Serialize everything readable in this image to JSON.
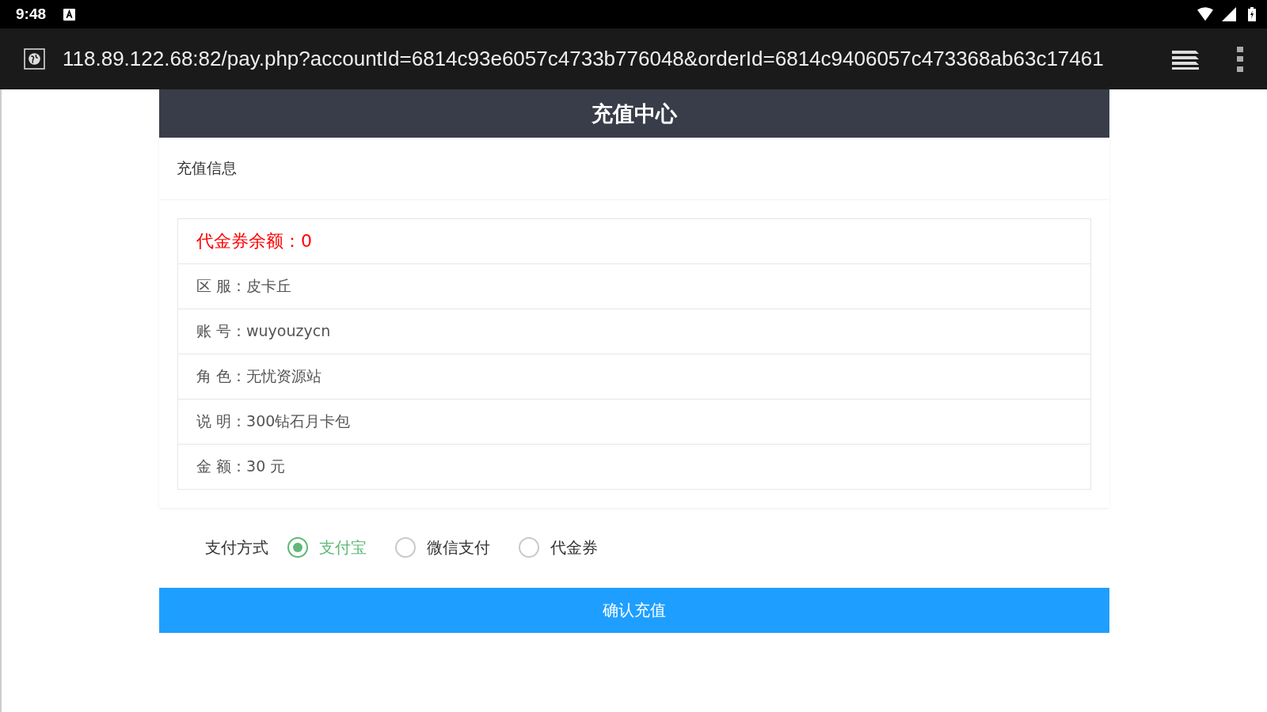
{
  "status_bar": {
    "time": "9:48"
  },
  "address_bar": {
    "url": "118.89.122.68:82/pay.php?accountId=6814c93e6057c4733b776048&orderId=6814c9406057c473368ab63c17461"
  },
  "page": {
    "title": "充值中心",
    "section_title": "充值信息",
    "rows": [
      {
        "text": "代金券余额：0",
        "kind": "alert"
      },
      {
        "text": "区 服：皮卡丘",
        "kind": "info"
      },
      {
        "text": "账 号：wuyouzycn",
        "kind": "info"
      },
      {
        "text": "角 色：无忧资源站",
        "kind": "info"
      },
      {
        "text": "说 明：300钻石月卡包",
        "kind": "info"
      },
      {
        "text": "金 额：30 元",
        "kind": "info"
      }
    ],
    "payment": {
      "label": "支付方式",
      "options": [
        {
          "label": "支付宝",
          "selected": true
        },
        {
          "label": "微信支付",
          "selected": false
        },
        {
          "label": "代金券",
          "selected": false
        }
      ]
    },
    "submit_button": "确认充值"
  }
}
